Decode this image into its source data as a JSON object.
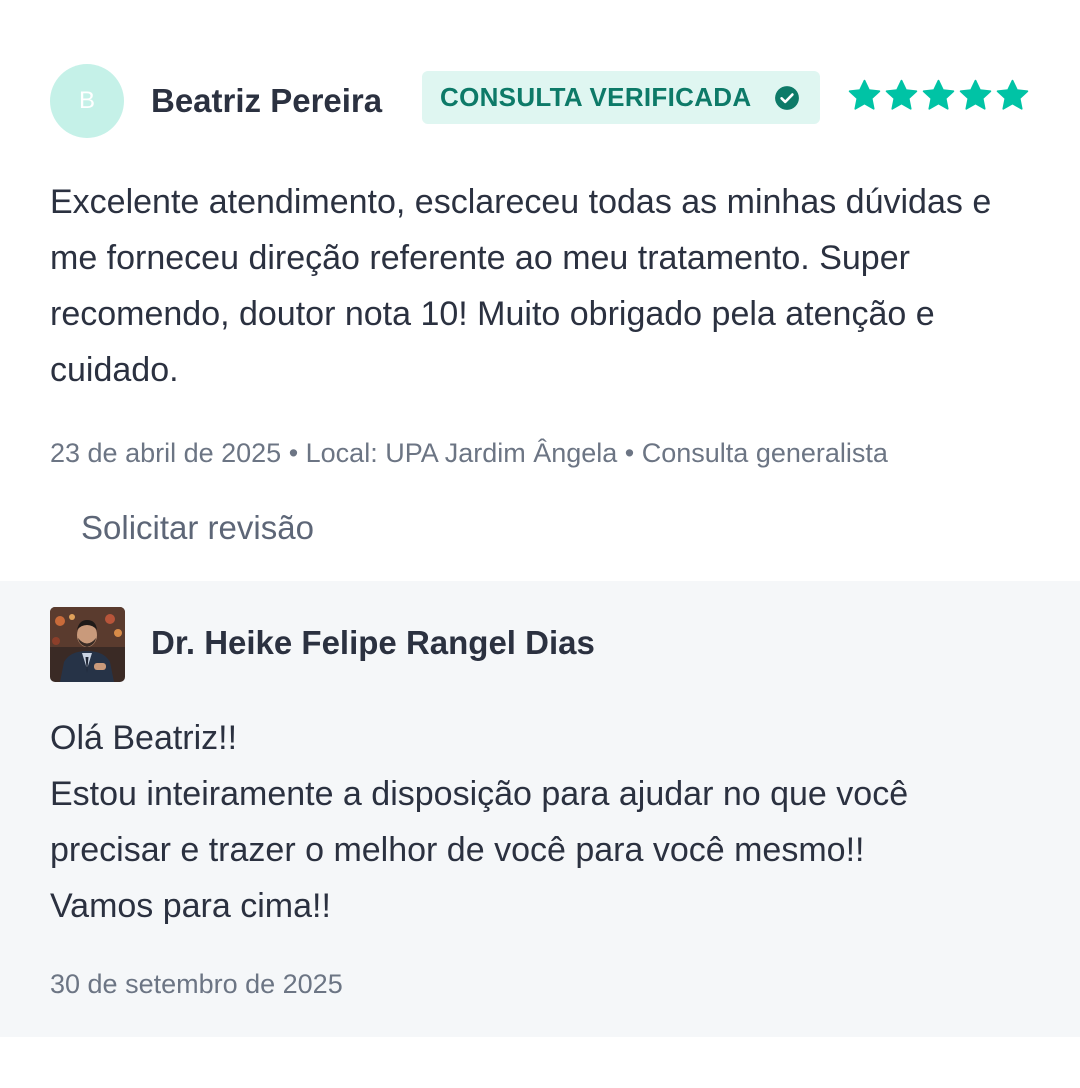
{
  "review": {
    "avatar_initial": "B",
    "reviewer_name": "Beatriz Pereira",
    "badge_label": "CONSULTA VERIFICADA",
    "badge_icon": "check-circle-icon",
    "rating": 5,
    "rating_max": 5,
    "text": "Excelente atendimento, esclareceu todas as minhas dúvidas e me forneceu direção referente ao meu tratamento. Super recomendo, doutor nota 10! Muito obrigado pela atenção e cuidado.",
    "meta": "23 de abril de 2025 • Local: UPA Jardim Ângela • Consulta generalista",
    "request_review_label": "Solicitar revisão"
  },
  "reply": {
    "doctor_name": "Dr. Heike Felipe Rangel Dias",
    "lines": [
      "Olá Beatriz!!",
      "Estou inteiramente a disposição para ajudar no que você",
      "precisar e trazer o melhor de você para você mesmo!!",
      "Vamos para cima!!"
    ],
    "date": "30 de setembro de 2025"
  },
  "colors": {
    "accent": "#00c3a5",
    "badge_bg": "#dff6f1",
    "badge_text": "#0d7a68",
    "reply_bg": "#f5f7f9",
    "text": "#2b3140",
    "muted": "#6c7584"
  }
}
